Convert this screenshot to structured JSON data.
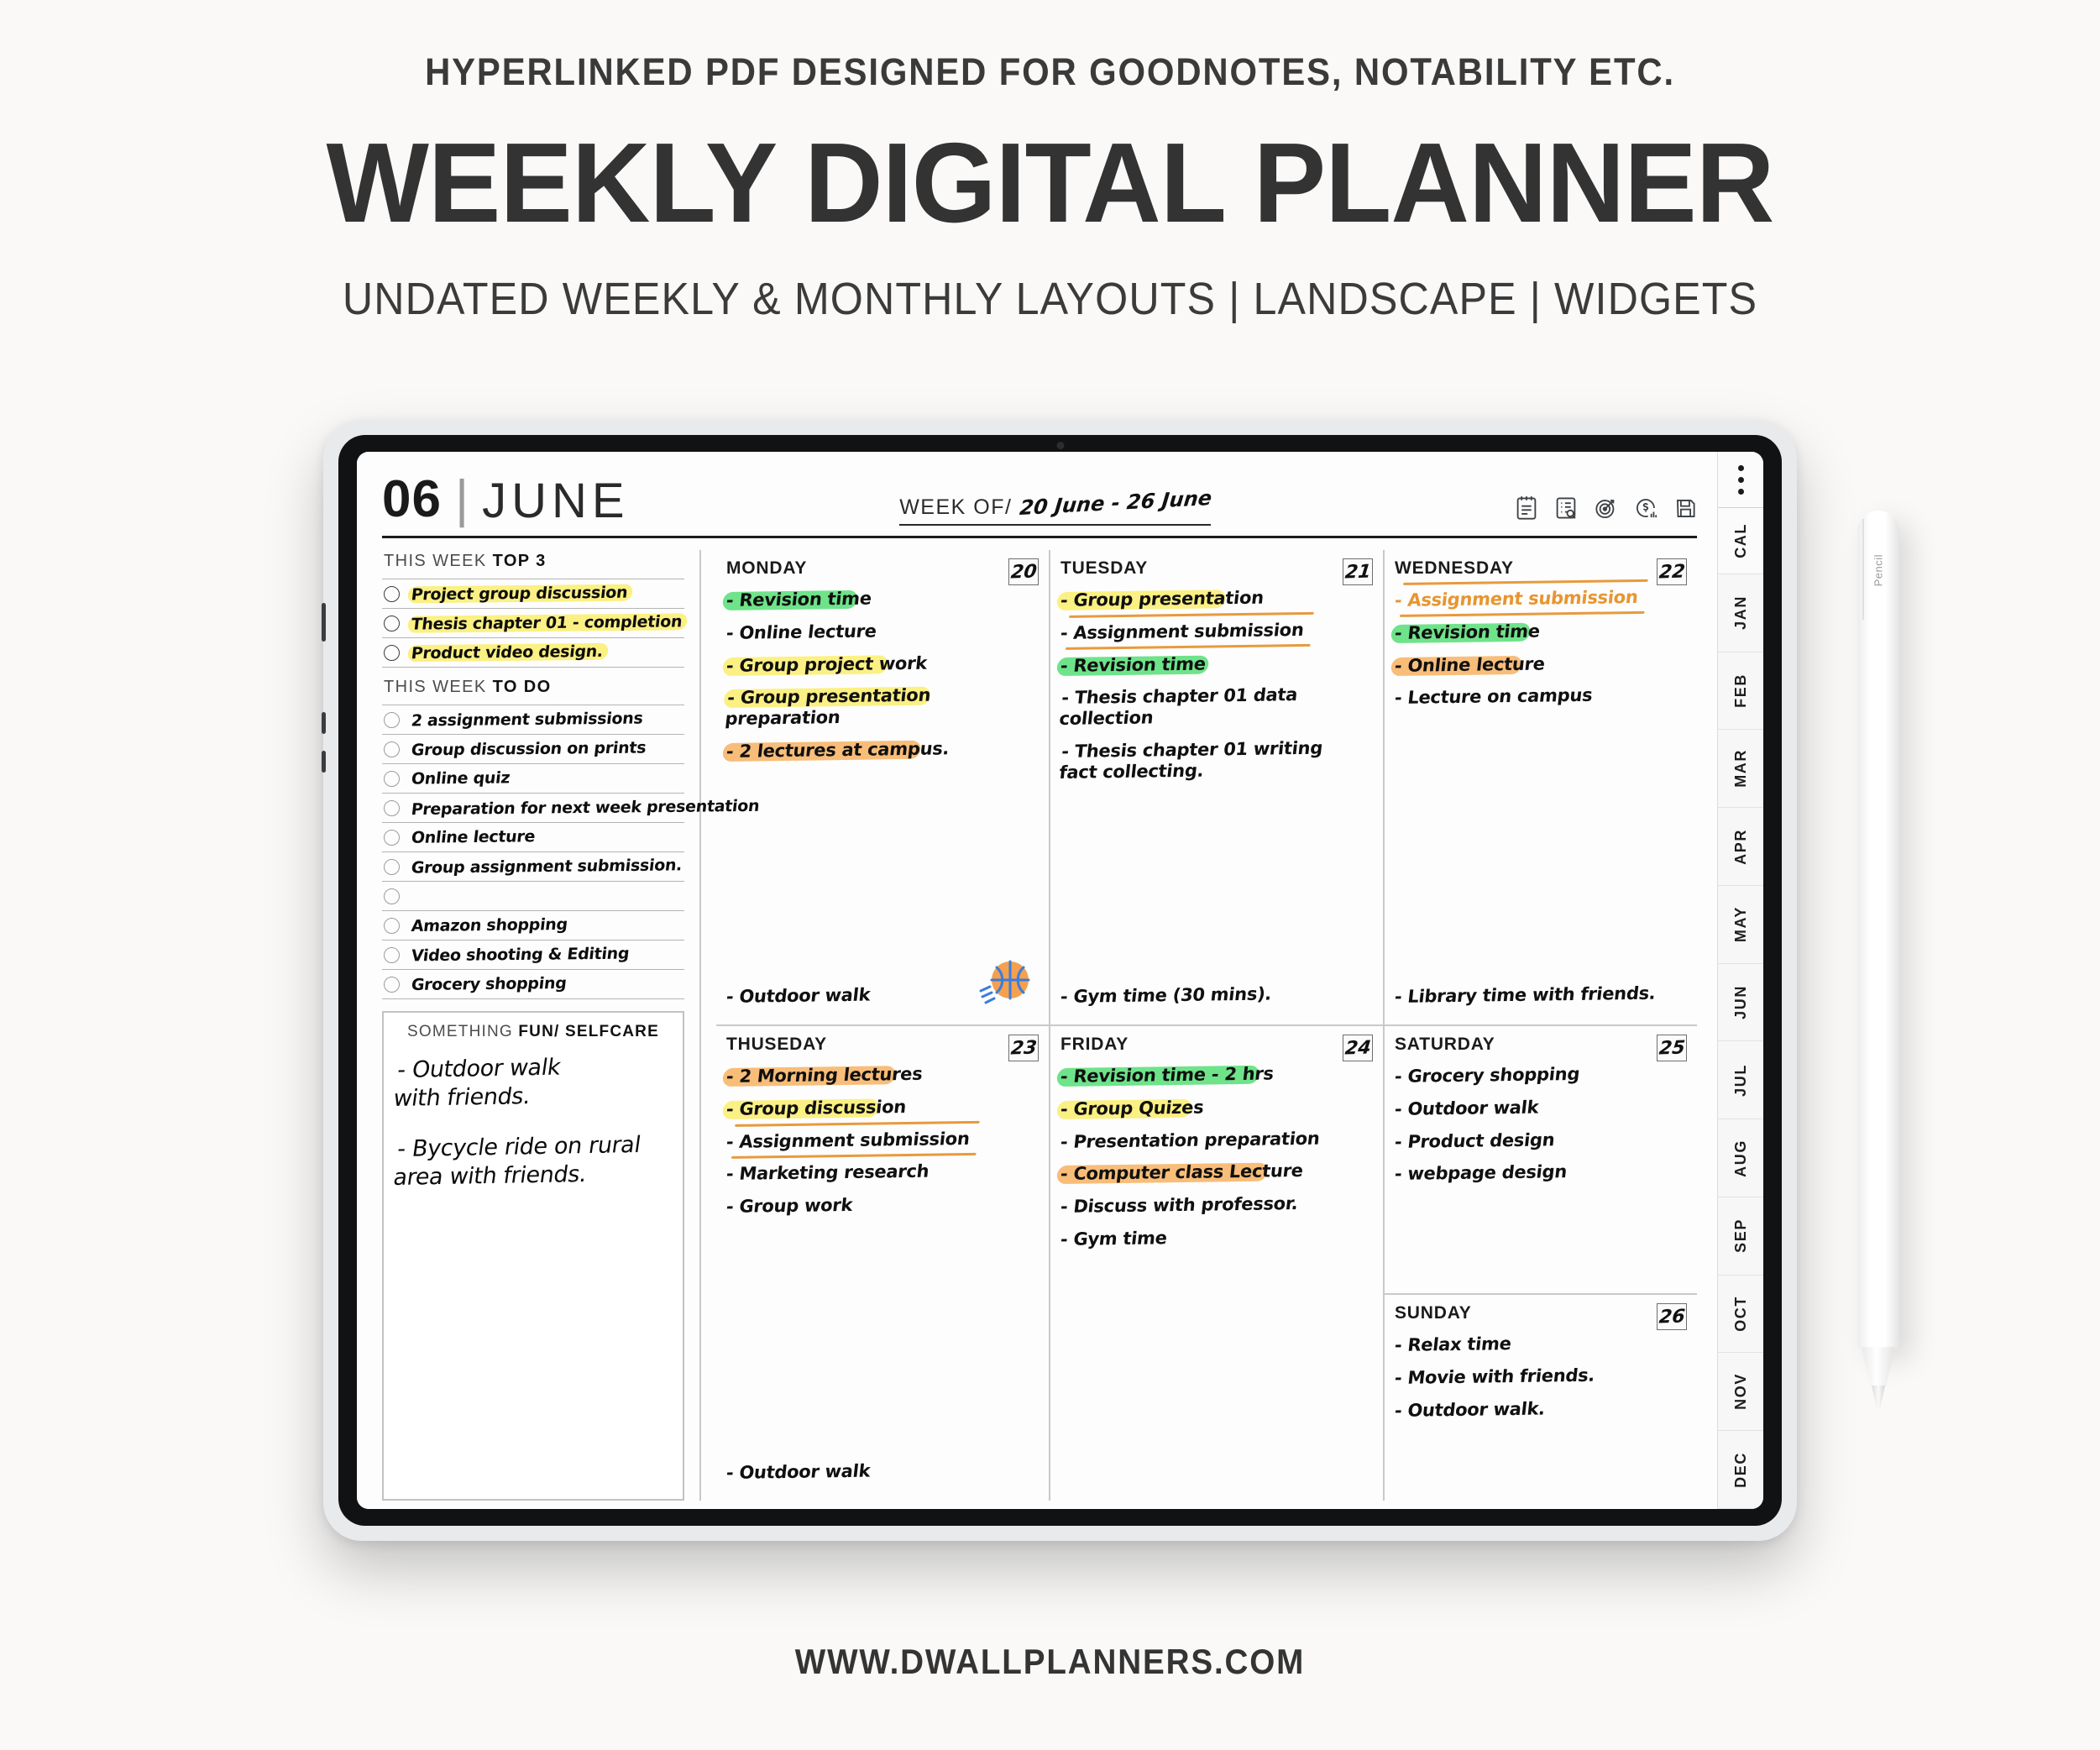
{
  "promo": {
    "eyebrow": "HYPERLINKED PDF DESIGNED FOR GOODNOTES, NOTABILITY ETC.",
    "title": "WEEKLY DIGITAL PLANNER",
    "subtitle": "UNDATED WEEKLY & MONTHLY LAYOUTS | LANDSCAPE | WIDGETS",
    "footer_url": "WWW.DWALLPLANNERS.COM"
  },
  "planner": {
    "month_number": "06",
    "month_separator": "|",
    "month_name": "JUNE",
    "week_of_label": "WEEK OF/",
    "week_of_value": "20 June - 26 June",
    "toolbar_icons": [
      "notepad-icon",
      "checklist-search-icon",
      "goal-target-icon",
      "finance-chart-icon",
      "save-icon"
    ],
    "left": {
      "top3_title_prefix": "THIS WEEK ",
      "top3_title_bold": "TOP 3",
      "top3_items": [
        {
          "text": "Project group discussion",
          "highlight": "yellow"
        },
        {
          "text": "Thesis chapter 01 - completion",
          "highlight": "yellow"
        },
        {
          "text": "Product video design.",
          "highlight": "yellow"
        }
      ],
      "todo_title_prefix": "THIS WEEK ",
      "todo_title_bold": "TO DO",
      "todo_items": [
        {
          "text": "2 assignment submissions"
        },
        {
          "text": "Group discussion on prints"
        },
        {
          "text": "Online quiz"
        },
        {
          "text": "Preparation for next week presentation"
        },
        {
          "text": "Online lecture"
        },
        {
          "text": "Group assignment submission."
        },
        {
          "text": ""
        },
        {
          "text": "Amazon shopping"
        },
        {
          "text": "Video shooting & Editing"
        },
        {
          "text": "Grocery shopping"
        }
      ],
      "fun_title_prefix": "SOMETHING ",
      "fun_title_bold": "FUN/ SELFCARE",
      "fun_notes": [
        "-  Outdoor walk\n        with friends.",
        "- Bycycle ride on rural\n        area with friends."
      ]
    },
    "days": [
      {
        "name": "MONDAY",
        "date": "20",
        "notes": [
          {
            "text": "- Revision time",
            "highlight": "green",
            "hl_width": 160
          },
          {
            "text": "- Online lecture",
            "highlight": "none"
          },
          {
            "text": "- Group project work",
            "highlight": "yellow",
            "hl_width": 196
          },
          {
            "text": "- Group presentation preparation",
            "highlight": "yellow",
            "hl_width": 245
          },
          {
            "text": "- 2 lectures at campus.",
            "highlight": "orange",
            "hl_width": 235
          }
        ],
        "trailing_notes": [
          {
            "text": "- Outdoor walk",
            "highlight": "none"
          }
        ],
        "sticker": "basketball-sticker"
      },
      {
        "name": "TUESDAY",
        "date": "21",
        "notes": [
          {
            "text": "- Group presentation",
            "highlight": "yellow",
            "hl_width": 200
          },
          {
            "text": "- Assignment submission",
            "highlight": "underline-orange"
          },
          {
            "text": "- Revision time",
            "highlight": "green",
            "hl_width": 180
          },
          {
            "text": "- Thesis chapter 01 data\n     collection",
            "highlight": "none"
          },
          {
            "text": "- Thesis chapter 01 writing\n     fact collecting.",
            "highlight": "none"
          }
        ],
        "trailing_notes": [
          {
            "text": "- Gym time (30 mins).",
            "highlight": "none"
          }
        ]
      },
      {
        "name": "WEDNESDAY",
        "date": "22",
        "notes": [
          {
            "text": "-   Assignment submission",
            "highlight": "underline-orange",
            "pen": "orange"
          },
          {
            "text": "- Revision time",
            "highlight": "green",
            "hl_width": 165
          },
          {
            "text": "- Online lecture",
            "highlight": "orange",
            "hl_width": 155
          },
          {
            "text": "- Lecture on campus",
            "highlight": "none"
          }
        ],
        "trailing_notes": [
          {
            "text": "- Library time with friends.",
            "highlight": "none"
          }
        ]
      },
      {
        "name": "THUSEDAY",
        "date": "23",
        "notes": [
          {
            "text": "- 2 Morning lectures",
            "highlight": "orange",
            "hl_width": 205
          },
          {
            "text": "- Group discussion",
            "highlight": "yellow",
            "hl_width": 185
          },
          {
            "text": "- Assignment submission",
            "highlight": "underline-orange"
          },
          {
            "text": "- Marketing research",
            "highlight": "none"
          },
          {
            "text": "- Group work",
            "highlight": "none"
          }
        ],
        "trailing_notes": [
          {
            "text": "- Outdoor walk",
            "highlight": "none"
          }
        ]
      },
      {
        "name": "FRIDAY",
        "date": "24",
        "notes": [
          {
            "text": "- Revision time - 2 hrs",
            "highlight": "green",
            "hl_width": 240
          },
          {
            "text": "- Group Quizes",
            "highlight": "yellow",
            "hl_width": 160
          },
          {
            "text": "- Presentation preparation",
            "highlight": "none"
          },
          {
            "text": "- Computer class Lecture",
            "highlight": "orange",
            "hl_width": 250
          },
          {
            "text": "- Discuss with professor.",
            "highlight": "none"
          },
          {
            "text": "- Gym time",
            "highlight": "none"
          }
        ],
        "trailing_notes": []
      },
      {
        "name": "SATURDAY",
        "date": "25",
        "notes": [
          {
            "text": "- Grocery shopping",
            "highlight": "none"
          },
          {
            "text": "- Outdoor walk",
            "highlight": "none"
          },
          {
            "text": "- Product design",
            "highlight": "none"
          },
          {
            "text": "- webpage design",
            "highlight": "none"
          }
        ],
        "trailing_notes": []
      },
      {
        "name": "SUNDAY",
        "date": "26",
        "notes": [
          {
            "text": "-  Relax time",
            "highlight": "none"
          },
          {
            "text": "-  Movie with friends.",
            "highlight": "none"
          },
          {
            "text": "- Outdoor walk.",
            "highlight": "none"
          }
        ],
        "trailing_notes": []
      }
    ],
    "tab_strip": {
      "dots": "more-dots",
      "items": [
        "CAL",
        "JAN",
        "FEB",
        "MAR",
        "APR",
        "MAY",
        "JUN",
        "JUL",
        "AUG",
        "SEP",
        "OCT",
        "NOV",
        "DEC"
      ]
    }
  },
  "pencil": {
    "label": "Pencil"
  },
  "colors": {
    "highlight_yellow": "#fbf083",
    "highlight_green": "#6fe38a",
    "highlight_orange": "#f8bd79",
    "pen_orange": "#e89530",
    "ink": "#101010",
    "page_bg": "#faf9f8"
  }
}
